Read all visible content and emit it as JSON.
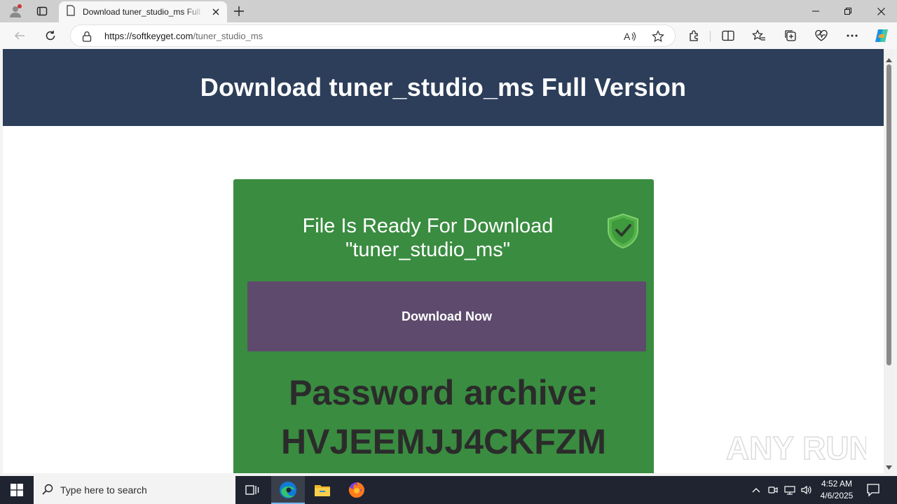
{
  "browser": {
    "tab_title": "Download tuner_studio_ms Full Version",
    "url_domain": "https://softkeyget.com",
    "url_path": "/tuner_studio_ms"
  },
  "page": {
    "header_title": "Download tuner_studio_ms Full Version",
    "ready_line1": "File Is Ready For Download",
    "ready_line2": "\"tuner_studio_ms\"",
    "download_button": "Download Now",
    "password_label": "Password archive:",
    "password_value": "HVJEEMJJ4CKFZM"
  },
  "watermark": {
    "text": "ANY RUN"
  },
  "taskbar": {
    "search_placeholder": "Type here to search",
    "time": "4:52 AM",
    "date": "4/6/2025"
  },
  "colors": {
    "header_bg": "#2c3e5a",
    "card_bg": "#3a8c40",
    "button_bg": "#5d4a6c",
    "taskbar_bg": "#1f2430"
  },
  "icons": [
    "profile-icon",
    "tab-actions-icon",
    "page-icon",
    "close-icon",
    "plus-icon",
    "minimize-icon",
    "restore-icon",
    "window-close-icon",
    "back-icon",
    "reload-icon",
    "lock-icon",
    "read-aloud-icon",
    "star-icon",
    "extensions-icon",
    "split-screen-icon",
    "favorites-icon",
    "collections-icon",
    "performance-icon",
    "more-icon",
    "copilot-icon",
    "shield-check-icon",
    "windows-logo-icon",
    "search-icon",
    "task-view-icon",
    "edge-icon",
    "file-explorer-icon",
    "firefox-icon",
    "chevron-up-icon",
    "meet-icon",
    "network-icon",
    "volume-icon",
    "notification-icon"
  ]
}
